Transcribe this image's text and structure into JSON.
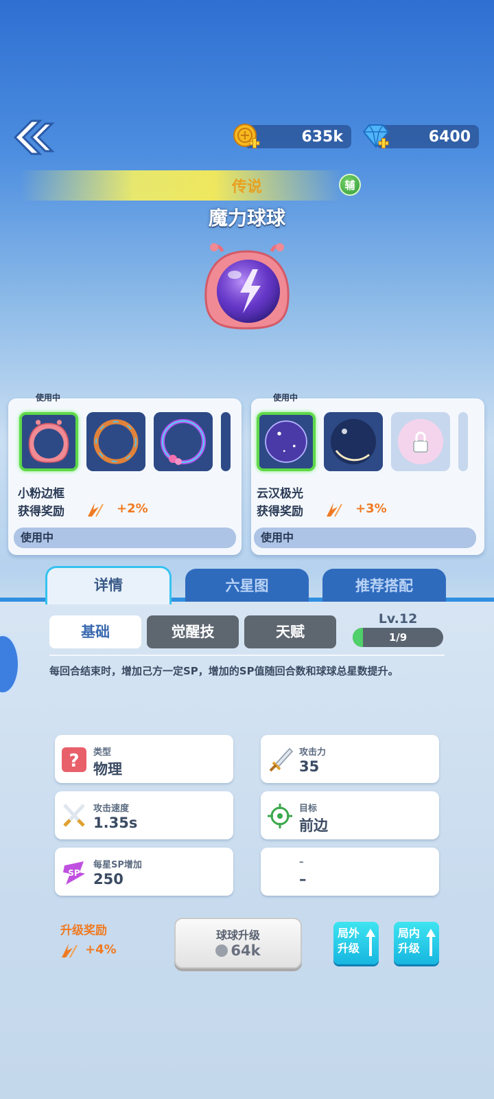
{
  "header": {
    "coins": "635k",
    "gems": "6400"
  },
  "ball": {
    "rarity": "传说",
    "role": "辅",
    "name": "魔力球球"
  },
  "skins": {
    "frame": {
      "in_use_tag": "使用中",
      "name": "小粉边框",
      "reward_label": "获得奖励",
      "reward_value": "+2%",
      "status": "使用中"
    },
    "effect": {
      "in_use_tag": "使用中",
      "name": "云汉极光",
      "reward_label": "获得奖励",
      "reward_value": "+3%",
      "status": "使用中"
    }
  },
  "tabs": [
    "详情",
    "六星图",
    "推荐搭配"
  ],
  "subtabs": [
    "基础",
    "觉醒技",
    "天赋"
  ],
  "level": {
    "label": "Lv.12",
    "progress_text": "1/9",
    "progress": 0.11
  },
  "description": "每回合结束时，增加己方一定SP，增加的SP值随回合数和球球总星数提升。",
  "stats": [
    {
      "label": "类型",
      "value": "物理",
      "icon": "question-icon"
    },
    {
      "label": "攻击力",
      "value": "35",
      "icon": "sword-icon"
    },
    {
      "label": "攻击速度",
      "value": "1.35s",
      "icon": "crossed-swords-icon"
    },
    {
      "label": "目标",
      "value": "前边",
      "icon": "target-icon"
    },
    {
      "label": "每星SP增加",
      "value": "250",
      "icon": "sp-icon"
    },
    {
      "label": "–",
      "value": "–",
      "icon": ""
    }
  ],
  "upgrade": {
    "reward_label": "升级奖励",
    "reward_value": "+4%",
    "button_title": "球球升级",
    "button_cost": "64k",
    "outside_label_1": "局外",
    "outside_label_2": "升级",
    "inside_label_1": "局内",
    "inside_label_2": "升级"
  },
  "colors": {
    "accent_orange": "#f07a22",
    "active_green": "#5ed84a",
    "tab_blue": "#2f6bbd",
    "mini_button_cyan": "#16b6e0"
  }
}
